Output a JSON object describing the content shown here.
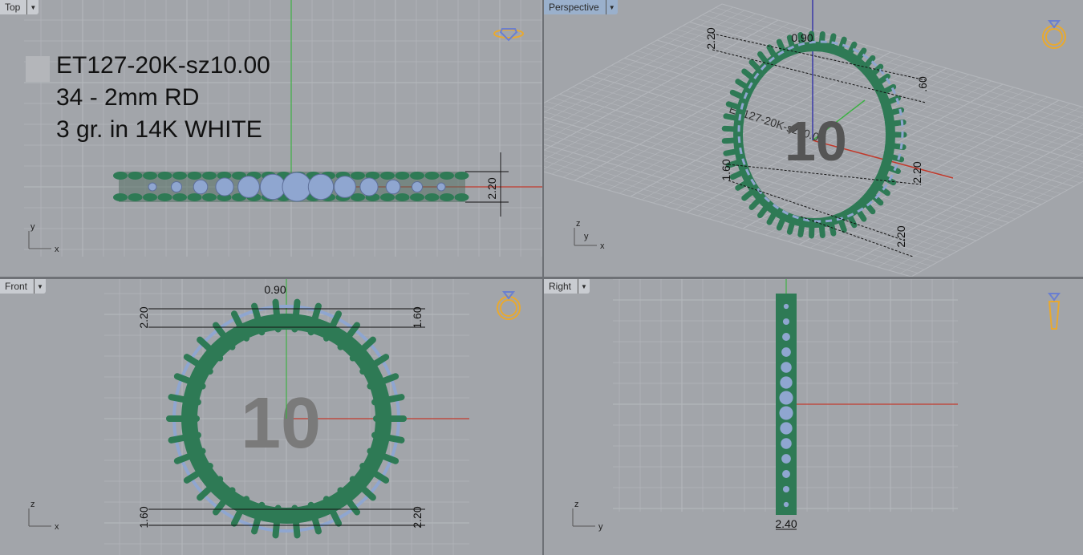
{
  "viewports": {
    "top": {
      "label": "Top",
      "axes": [
        "y",
        "x"
      ],
      "dims": [
        "2.20"
      ]
    },
    "perspective": {
      "label": "Perspective",
      "axes": [
        "z",
        "y",
        "x"
      ],
      "dims": [
        "0.90",
        "2.20",
        ".60",
        "1.60",
        "2.20",
        "2.20"
      ]
    },
    "front": {
      "label": "Front",
      "axes": [
        "z",
        "x"
      ],
      "dims": [
        "0.90",
        "2.20",
        "1.60",
        "1.60",
        "2.20"
      ],
      "size_text": "10"
    },
    "right": {
      "label": "Right",
      "axes": [
        "z",
        "y"
      ],
      "dims": [
        "2.40"
      ]
    }
  },
  "note": {
    "line1": "ET127-20K-sz10.00",
    "line2": "34 - 2mm RD",
    "line3": "3 gr.  in 14K WHITE"
  },
  "stone_count": 34,
  "colors": {
    "metal": "#2e7a55",
    "stone": "#8fa6d0",
    "grid": "#b3b6bb",
    "x_axis": "#c0392b",
    "y_axis": "#3cb043",
    "z_axis": "#3a3aa8",
    "icon": "#e8a930"
  },
  "icons": [
    "ring-top-icon",
    "ring-perspective-icon",
    "ring-front-icon",
    "ring-right-icon",
    "viewport-menu-icon"
  ]
}
